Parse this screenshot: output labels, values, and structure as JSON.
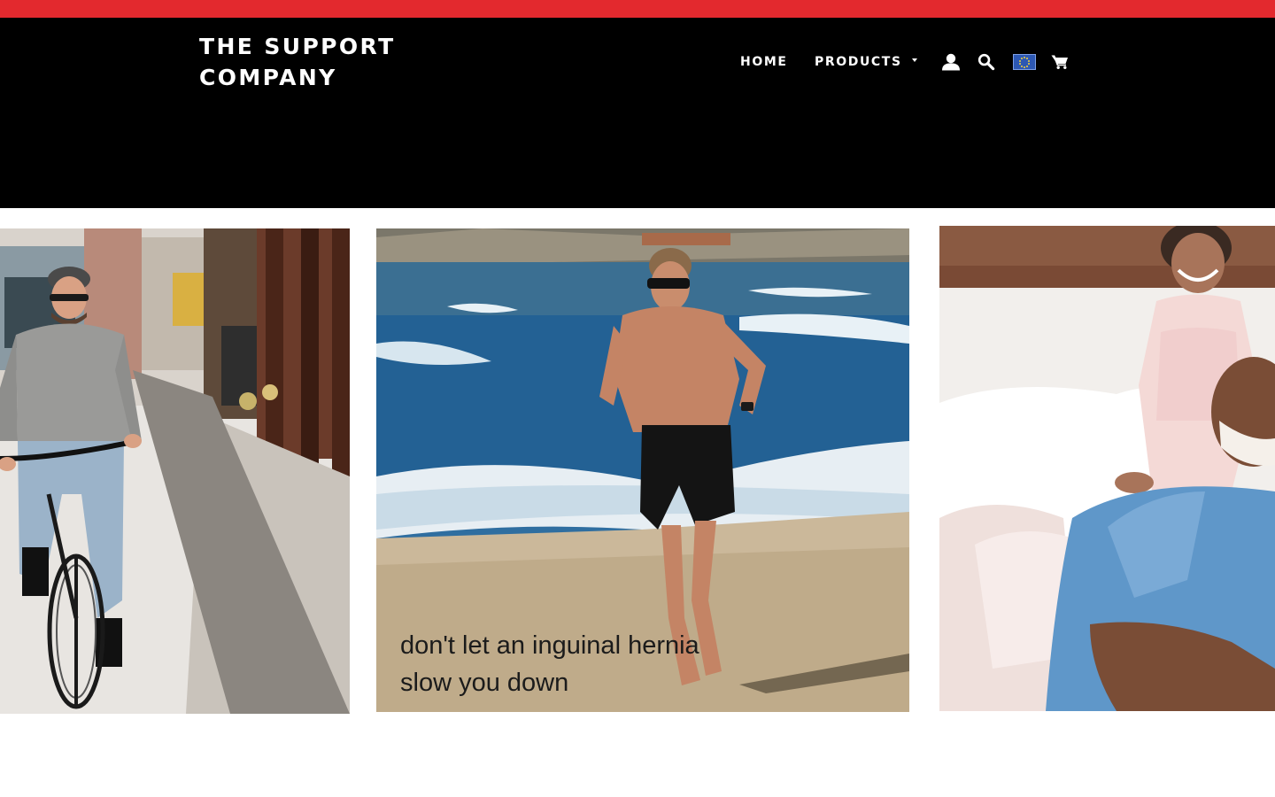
{
  "announcement_bar": {
    "color": "#e3292e"
  },
  "header": {
    "background": "#000000",
    "logo_line1": "THE SUPPORT",
    "logo_line2": "COMPANY",
    "nav": {
      "home_label": "HOME",
      "products_label": "PRODUCTS"
    },
    "icons": {
      "account": "account-icon",
      "search": "search-icon",
      "currency": "eu-flag-icon",
      "cart": "cart-icon"
    }
  },
  "slides": [
    {
      "image": "man riding a bicycle on a sunny street"
    },
    {
      "image": "man running barefoot on a beach",
      "caption": "don't let an inguinal hernia slow you down"
    },
    {
      "image": "smiling man with a young girl on a bed"
    }
  ]
}
